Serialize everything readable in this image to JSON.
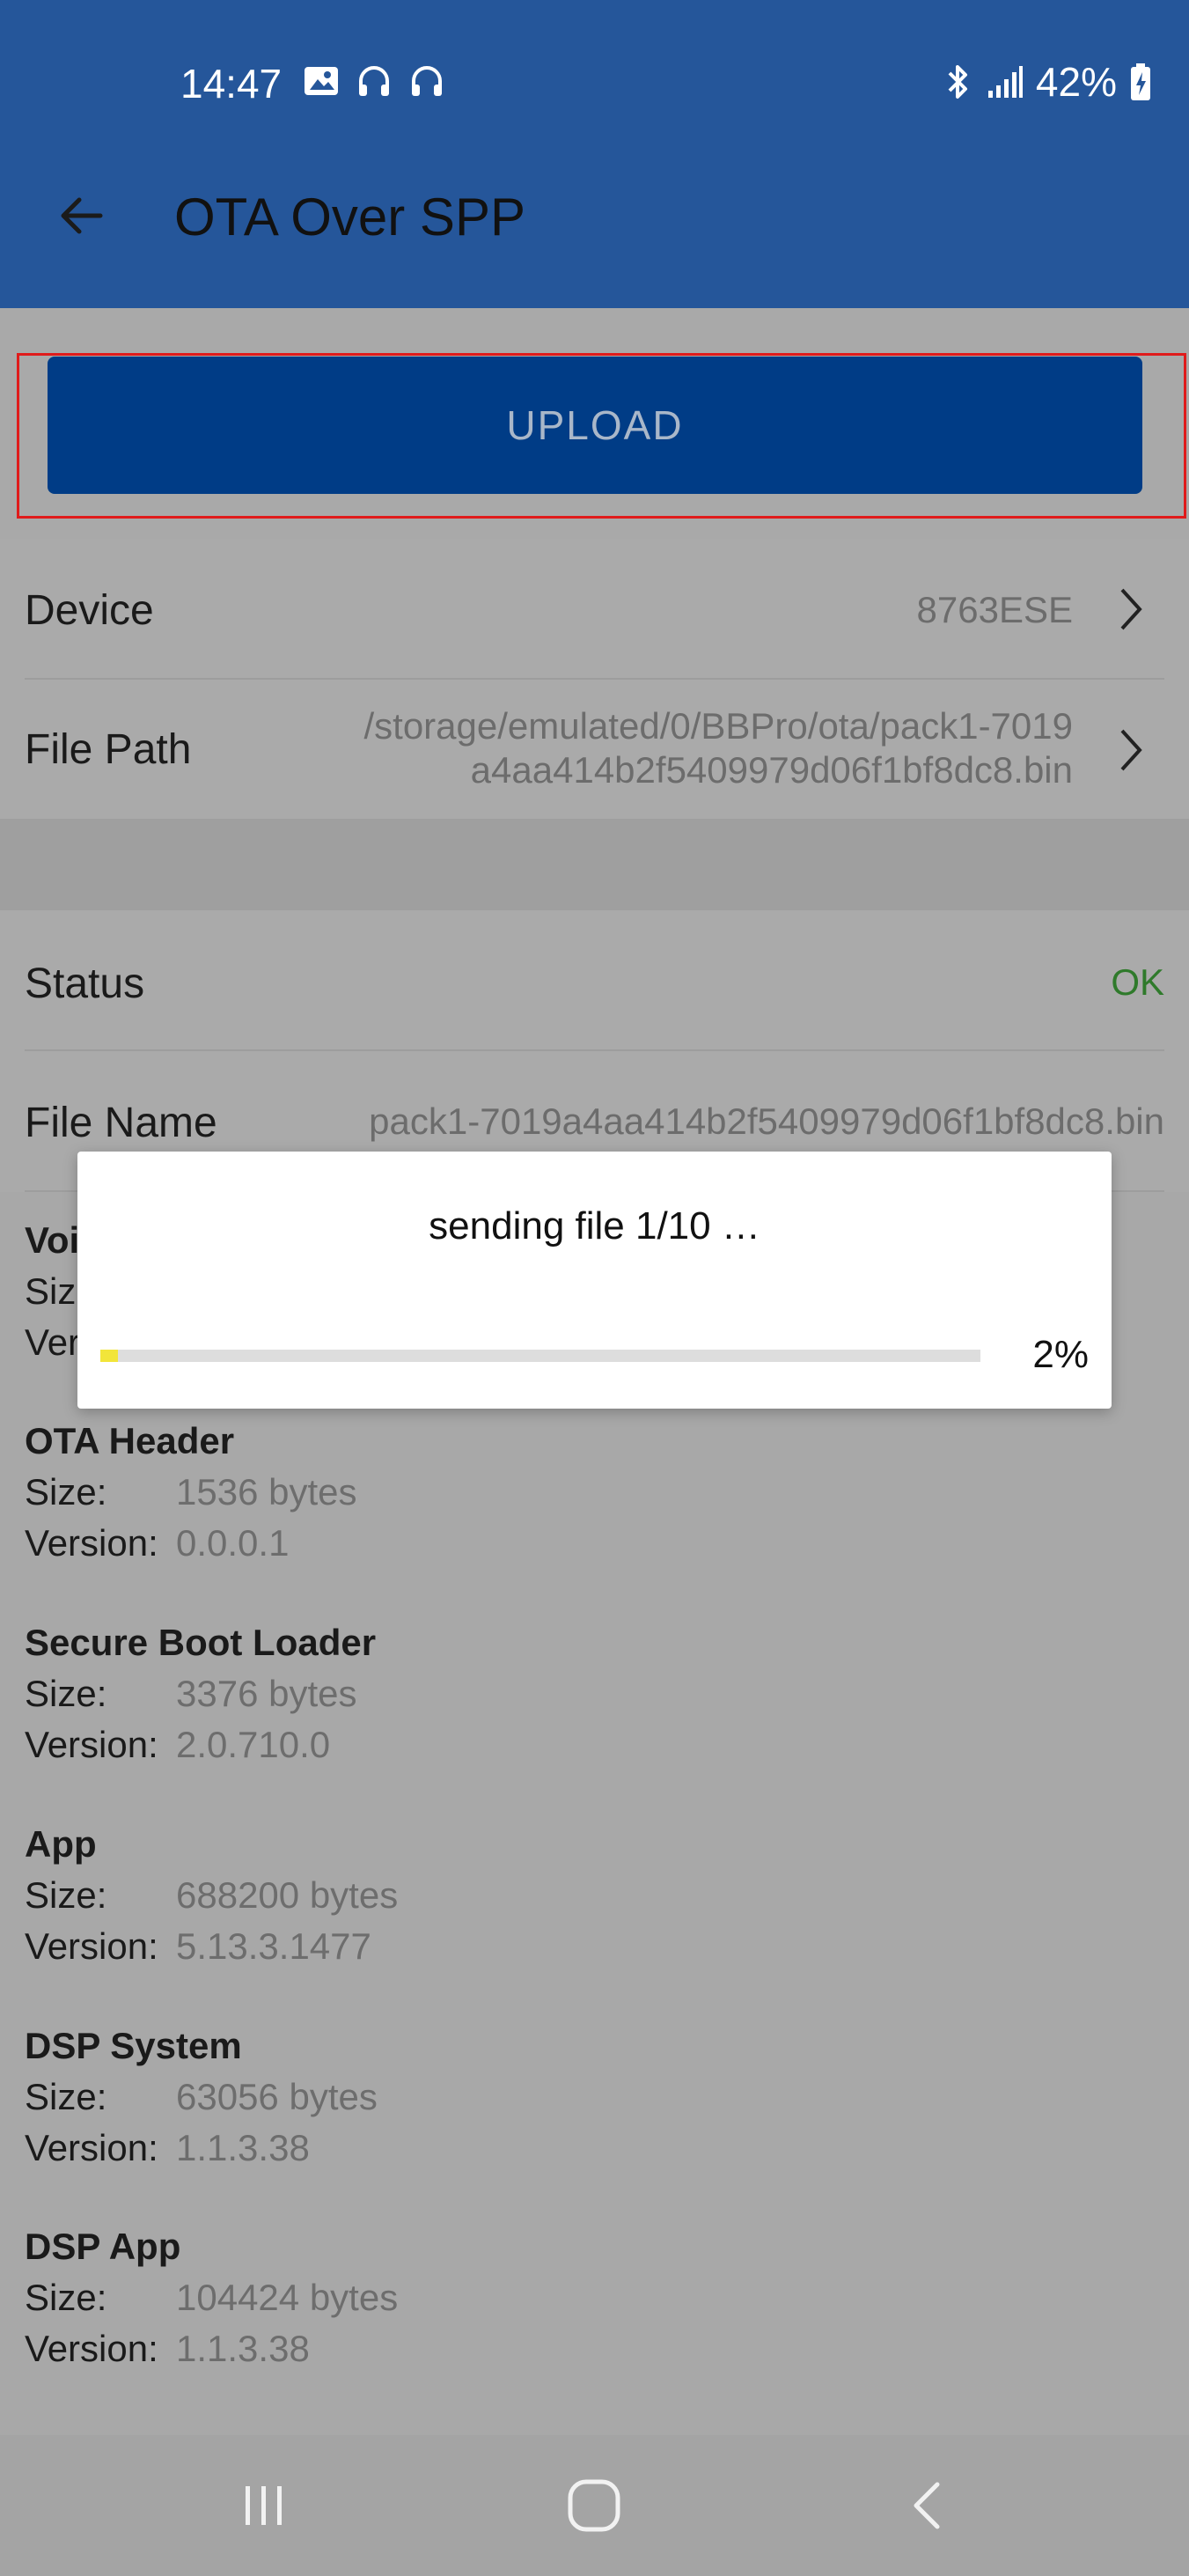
{
  "status_bar": {
    "time": "14:47",
    "battery_percent": "42%",
    "icons_left": [
      "image-icon",
      "headphones-icon",
      "headphones-icon"
    ],
    "icons_right": [
      "bluetooth-icon",
      "signal-icon",
      "battery-charging-icon"
    ]
  },
  "app_bar": {
    "title": "OTA Over SPP",
    "back_icon": "arrow-left-icon"
  },
  "upload": {
    "label": "UPLOAD"
  },
  "device_row": {
    "label": "Device",
    "value": "8763ESE"
  },
  "filepath_row": {
    "label": "File Path",
    "value_line1": "/storage/emulated/0/BBPro/ota/pack1-7019",
    "value_line2": "a4aa414b2f5409979d06f1bf8dc8.bin"
  },
  "status_row": {
    "label": "Status",
    "value": "OK"
  },
  "filename_row": {
    "label": "File Name",
    "value": "pack1-7019a4aa414b2f5409979d06f1bf8dc8.bin"
  },
  "components": [
    {
      "title": "Voi",
      "size_label": "Siz",
      "size": "",
      "version_label": "Ver",
      "version": ""
    },
    {
      "title": "OTA Header",
      "size_label": "Size:",
      "size": "1536 bytes",
      "version_label": "Version:",
      "version": "0.0.0.1"
    },
    {
      "title": "Secure Boot Loader",
      "size_label": "Size:",
      "size": "3376 bytes",
      "version_label": "Version:",
      "version": "2.0.710.0"
    },
    {
      "title": "App",
      "size_label": "Size:",
      "size": "688200 bytes",
      "version_label": "Version:",
      "version": "5.13.3.1477"
    },
    {
      "title": "DSP System",
      "size_label": "Size:",
      "size": "63056 bytes",
      "version_label": "Version:",
      "version": "1.1.3.38"
    },
    {
      "title": "DSP App",
      "size_label": "Size:",
      "size": "104424 bytes",
      "version_label": "Version:",
      "version": "1.1.3.38"
    }
  ],
  "dialog": {
    "message": "sending file 1/10 …",
    "progress_fraction": 0.02,
    "progress_label": "2%"
  },
  "colors": {
    "app_bar": "#25569a",
    "upload_button": "#003c86",
    "highlight_border": "#e01b1b",
    "status_ok": "#2f7a2b",
    "progress_fill": "#f2e53a"
  },
  "nav_bar": {
    "recents_icon": "recents-icon",
    "home_icon": "home-icon",
    "back_icon": "back-chevron-icon"
  }
}
